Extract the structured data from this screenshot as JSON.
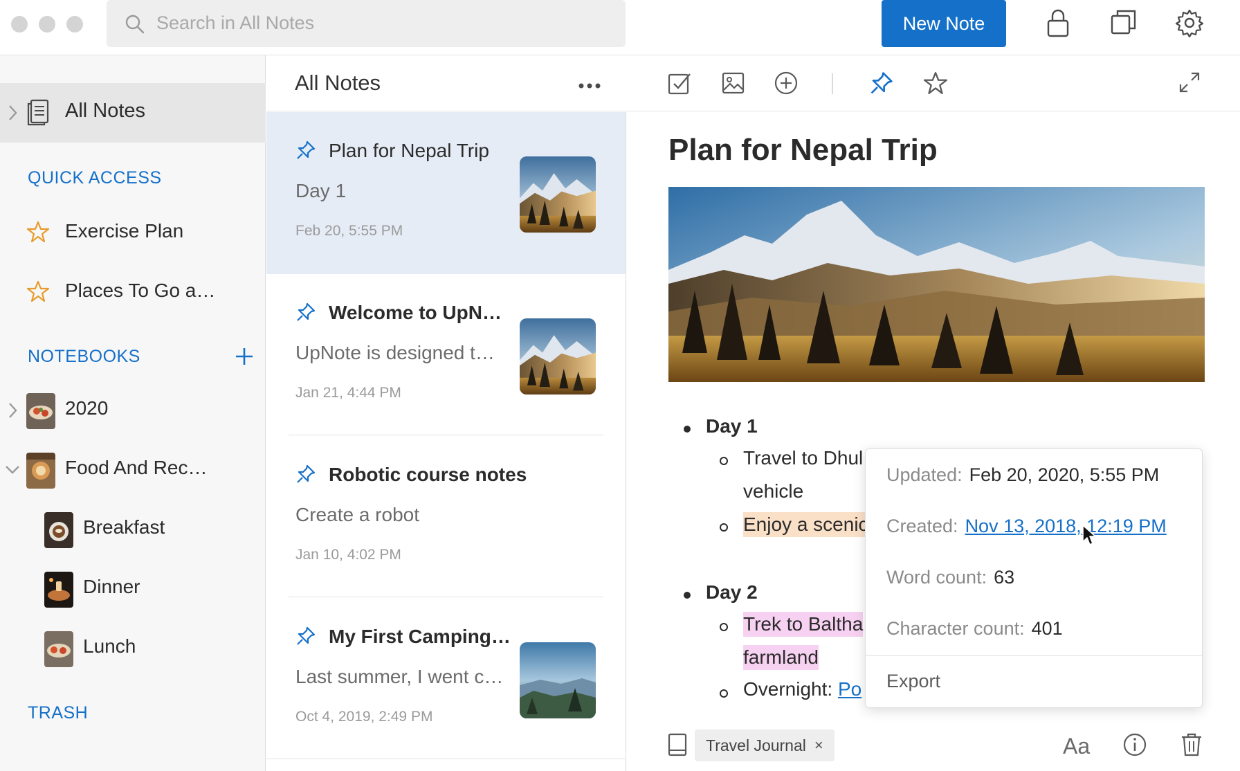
{
  "app": {
    "search_placeholder": "Search in All Notes",
    "new_note_label": "New Note",
    "accent_color": "#1570c9",
    "icons": [
      "search-icon",
      "lock-icon",
      "duplicate-window-icon",
      "gear-icon"
    ]
  },
  "sidebar": {
    "all_notes_label": "All Notes",
    "quick_access_heading": "QUICK ACCESS",
    "quick_access": [
      {
        "label": "Exercise Plan",
        "icon": "star-icon"
      },
      {
        "label": "Places To Go a…",
        "icon": "star-icon"
      }
    ],
    "notebooks_heading": "NOTEBOOKS",
    "add_notebook_icon": "plus-icon",
    "notebooks": [
      {
        "label": "2020",
        "collapsed": true
      },
      {
        "label": "Food And Rec…",
        "expanded": true
      },
      {
        "label": "Breakfast"
      },
      {
        "label": "Dinner"
      },
      {
        "label": "Lunch"
      }
    ],
    "trash_label": "TRASH"
  },
  "note_list": {
    "title": "All Notes",
    "more_icon": "ellipsis-icon",
    "notes": [
      {
        "title": "Plan for Nepal Trip",
        "snippet": "Day 1",
        "date": "Feb 20, 5:55 PM",
        "pinned": true,
        "selected": true
      },
      {
        "title": "Welcome to UpN…",
        "snippet": "UpNote is designed t…",
        "date": "Jan 21, 4:44 PM",
        "pinned": true
      },
      {
        "title": "Robotic course notes",
        "snippet": "Create a robot",
        "date": "Jan 10, 4:02 PM",
        "pinned": true
      },
      {
        "title": "My First Camping…",
        "snippet": "Last summer, I went c…",
        "date": "Oct 4, 2019, 2:49 PM",
        "pinned": true
      }
    ]
  },
  "editor": {
    "toolbar_icons": [
      "checkbox-icon",
      "image-icon",
      "add-circle-icon",
      "pin-icon",
      "star-icon",
      "expand-icon"
    ],
    "title": "Plan for Nepal Trip",
    "day1": {
      "heading": "Day 1",
      "item1_a": "Travel to Dhul",
      "item1_b": "vehicle",
      "item2": "Enjoy a scenic"
    },
    "day2": {
      "heading": "Day 2",
      "item1_a": "Trek to Baltha",
      "item1_b": "farmland",
      "item2_label": "Overnight: ",
      "item2_link": "Po"
    },
    "tag": "Travel Journal",
    "tag_remove": "×",
    "font_button": "Aa",
    "bottom_icons": [
      "notebook-icon",
      "font-icon",
      "info-icon",
      "trash-icon"
    ]
  },
  "info_popup": {
    "updated_label": "Updated:",
    "updated_value": "Feb 20, 2020, 5:55 PM",
    "created_label": "Created:",
    "created_value": "Nov 13, 2018, 12:19 PM",
    "word_count_label": "Word count:",
    "word_count_value": "63",
    "char_count_label": "Character count:",
    "char_count_value": "401",
    "export_label": "Export"
  }
}
